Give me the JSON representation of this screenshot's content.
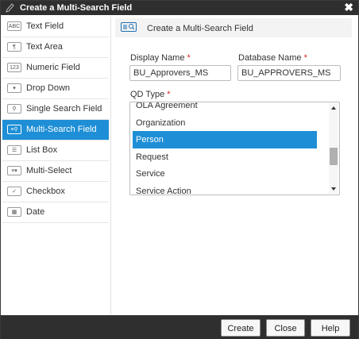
{
  "window": {
    "title": "Create a Multi-Search Field",
    "close_glyph": "✖"
  },
  "sidebar": {
    "items": [
      {
        "label": "Text Field",
        "icon": "ABC",
        "icon_name": "text-field-icon",
        "active": false
      },
      {
        "label": "Text Area",
        "icon": "¶",
        "icon_name": "text-area-icon",
        "active": false
      },
      {
        "label": "Numeric Field",
        "icon": "123",
        "icon_name": "numeric-field-icon",
        "active": false
      },
      {
        "label": "Drop Down",
        "icon": "▾",
        "icon_name": "drop-down-icon",
        "active": false
      },
      {
        "label": "Single Search Field",
        "icon": "⚲",
        "icon_name": "single-search-icon",
        "active": false
      },
      {
        "label": "Multi-Search Field",
        "icon": "≡⚲",
        "icon_name": "multi-search-icon",
        "active": true
      },
      {
        "label": "List Box",
        "icon": "☰",
        "icon_name": "list-box-icon",
        "active": false
      },
      {
        "label": "Multi-Select",
        "icon": "≡▾",
        "icon_name": "multi-select-icon",
        "active": false
      },
      {
        "label": "Checkbox",
        "icon": "✓",
        "icon_name": "checkbox-icon",
        "active": false
      },
      {
        "label": "Date",
        "icon": "▦",
        "icon_name": "date-icon",
        "active": false
      }
    ]
  },
  "main": {
    "header": "Create a Multi-Search Field",
    "display_name": {
      "label": "Display Name",
      "required": "*",
      "value": "BU_Approvers_MS"
    },
    "database_name": {
      "label": "Database Name",
      "required": "*",
      "value": "BU_APPROVERS_MS"
    },
    "qd_type": {
      "label": "QD Type",
      "required": "*",
      "options": [
        "OLA Agreement",
        "Organization",
        "Person",
        "Request",
        "Service",
        "Service Action"
      ],
      "selected": "Person"
    }
  },
  "footer": {
    "create": "Create",
    "close": "Close",
    "help": "Help"
  },
  "colors": {
    "accent": "#1e8fd6",
    "titlebar": "#2f2f2f",
    "required": "#d9261c"
  }
}
